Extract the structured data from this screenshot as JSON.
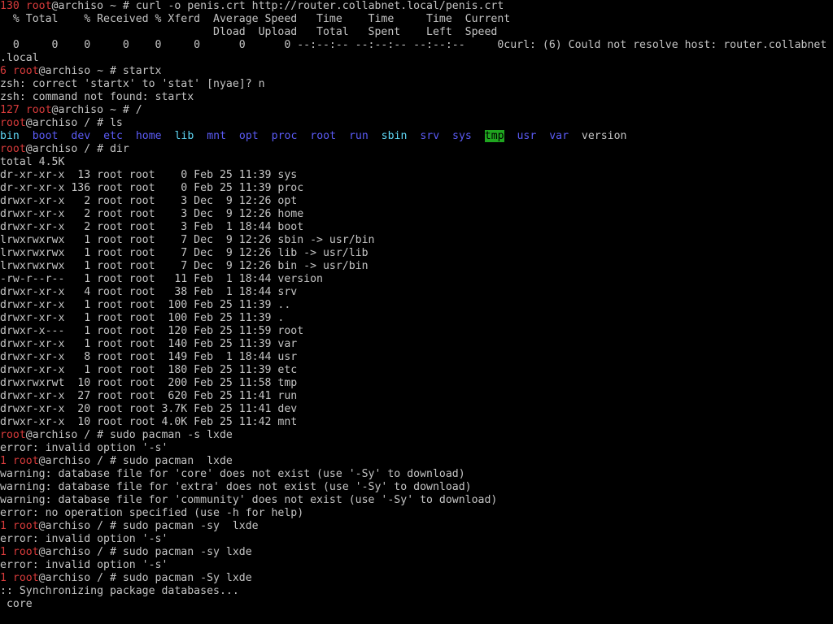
{
  "terminal": {
    "colors": {
      "background": "#000000",
      "foreground": "#c4c4c4",
      "prompt_status": "#d83b3b",
      "directory": "#5b5bf5",
      "symlink": "#5fd7f5",
      "sticky_dir_bg": "#1fa51f"
    },
    "lines": [
      [
        {
          "c": "red",
          "t": "130 root"
        },
        {
          "c": "default",
          "t": "@archiso ~ # curl -o penis.crt http://router.collabnet.local/penis.crt"
        }
      ],
      [
        {
          "c": "default",
          "t": "  % Total    % Received % Xferd  Average Speed   Time    Time     Time  Current"
        }
      ],
      [
        {
          "c": "default",
          "t": "                                 Dload  Upload   Total   Spent    Left  Speed"
        }
      ],
      [
        {
          "c": "default",
          "t": "  0     0    0     0    0     0      0      0 --:--:-- --:--:-- --:--:--     0curl: (6) Could not resolve host: router.collabnet"
        }
      ],
      [
        {
          "c": "default",
          "t": ".local"
        }
      ],
      [
        {
          "c": "red",
          "t": "6 root"
        },
        {
          "c": "default",
          "t": "@archiso ~ # startx"
        }
      ],
      [
        {
          "c": "default",
          "t": "zsh: correct 'startx' to 'stat' [nyae]? n"
        }
      ],
      [
        {
          "c": "default",
          "t": "zsh: command not found: startx"
        }
      ],
      [
        {
          "c": "red",
          "t": "127 root"
        },
        {
          "c": "default",
          "t": "@archiso ~ # /"
        }
      ],
      [
        {
          "c": "red",
          "t": "root"
        },
        {
          "c": "default",
          "t": "@archiso / # ls"
        }
      ],
      [
        {
          "c": "cyan",
          "t": "bin"
        },
        {
          "c": "default",
          "t": "  "
        },
        {
          "c": "blue",
          "t": "boot"
        },
        {
          "c": "default",
          "t": "  "
        },
        {
          "c": "blue",
          "t": "dev"
        },
        {
          "c": "default",
          "t": "  "
        },
        {
          "c": "blue",
          "t": "etc"
        },
        {
          "c": "default",
          "t": "  "
        },
        {
          "c": "blue",
          "t": "home"
        },
        {
          "c": "default",
          "t": "  "
        },
        {
          "c": "cyan",
          "t": "lib"
        },
        {
          "c": "default",
          "t": "  "
        },
        {
          "c": "blue",
          "t": "mnt"
        },
        {
          "c": "default",
          "t": "  "
        },
        {
          "c": "blue",
          "t": "opt"
        },
        {
          "c": "default",
          "t": "  "
        },
        {
          "c": "blue",
          "t": "proc"
        },
        {
          "c": "default",
          "t": "  "
        },
        {
          "c": "blue",
          "t": "root"
        },
        {
          "c": "default",
          "t": "  "
        },
        {
          "c": "blue",
          "t": "run"
        },
        {
          "c": "default",
          "t": "  "
        },
        {
          "c": "cyan",
          "t": "sbin"
        },
        {
          "c": "default",
          "t": "  "
        },
        {
          "c": "blue",
          "t": "srv"
        },
        {
          "c": "default",
          "t": "  "
        },
        {
          "c": "blue",
          "t": "sys"
        },
        {
          "c": "default",
          "t": "  "
        },
        {
          "c": "dirhl",
          "t": "tmp"
        },
        {
          "c": "default",
          "t": "  "
        },
        {
          "c": "blue",
          "t": "usr"
        },
        {
          "c": "default",
          "t": "  "
        },
        {
          "c": "blue",
          "t": "var"
        },
        {
          "c": "default",
          "t": "  version"
        }
      ],
      [
        {
          "c": "red",
          "t": "root"
        },
        {
          "c": "default",
          "t": "@archiso / # dir"
        }
      ],
      [
        {
          "c": "default",
          "t": "total 4.5K"
        }
      ],
      [
        {
          "c": "default",
          "t": "dr-xr-xr-x  13 root root    0 Feb 25 11:39 sys"
        }
      ],
      [
        {
          "c": "default",
          "t": "dr-xr-xr-x 136 root root    0 Feb 25 11:39 proc"
        }
      ],
      [
        {
          "c": "default",
          "t": "drwxr-xr-x   2 root root    3 Dec  9 12:26 opt"
        }
      ],
      [
        {
          "c": "default",
          "t": "drwxr-xr-x   2 root root    3 Dec  9 12:26 home"
        }
      ],
      [
        {
          "c": "default",
          "t": "drwxr-xr-x   2 root root    3 Feb  1 18:44 boot"
        }
      ],
      [
        {
          "c": "default",
          "t": "lrwxrwxrwx   1 root root    7 Dec  9 12:26 sbin -> usr/bin"
        }
      ],
      [
        {
          "c": "default",
          "t": "lrwxrwxrwx   1 root root    7 Dec  9 12:26 lib -> usr/lib"
        }
      ],
      [
        {
          "c": "default",
          "t": "lrwxrwxrwx   1 root root    7 Dec  9 12:26 bin -> usr/bin"
        }
      ],
      [
        {
          "c": "default",
          "t": "-rw-r--r--   1 root root   11 Feb  1 18:44 version"
        }
      ],
      [
        {
          "c": "default",
          "t": "drwxr-xr-x   4 root root   38 Feb  1 18:44 srv"
        }
      ],
      [
        {
          "c": "default",
          "t": "drwxr-xr-x   1 root root  100 Feb 25 11:39 .."
        }
      ],
      [
        {
          "c": "default",
          "t": "drwxr-xr-x   1 root root  100 Feb 25 11:39 ."
        }
      ],
      [
        {
          "c": "default",
          "t": "drwxr-x---   1 root root  120 Feb 25 11:59 root"
        }
      ],
      [
        {
          "c": "default",
          "t": "drwxr-xr-x   1 root root  140 Feb 25 11:39 var"
        }
      ],
      [
        {
          "c": "default",
          "t": "drwxr-xr-x   8 root root  149 Feb  1 18:44 usr"
        }
      ],
      [
        {
          "c": "default",
          "t": "drwxr-xr-x   1 root root  180 Feb 25 11:39 etc"
        }
      ],
      [
        {
          "c": "default",
          "t": "drwxrwxrwt  10 root root  200 Feb 25 11:58 tmp"
        }
      ],
      [
        {
          "c": "default",
          "t": "drwxr-xr-x  27 root root  620 Feb 25 11:41 run"
        }
      ],
      [
        {
          "c": "default",
          "t": "drwxr-xr-x  20 root root 3.7K Feb 25 11:41 dev"
        }
      ],
      [
        {
          "c": "default",
          "t": "drwxr-xr-x  10 root root 4.0K Feb 25 11:42 mnt"
        }
      ],
      [
        {
          "c": "red",
          "t": "root"
        },
        {
          "c": "default",
          "t": "@archiso / # sudo pacman -s lxde"
        }
      ],
      [
        {
          "c": "default",
          "t": "error: invalid option '-s'"
        }
      ],
      [
        {
          "c": "red",
          "t": "1 root"
        },
        {
          "c": "default",
          "t": "@archiso / # sudo pacman  lxde"
        }
      ],
      [
        {
          "c": "default",
          "t": "warning: database file for 'core' does not exist (use '-Sy' to download)"
        }
      ],
      [
        {
          "c": "default",
          "t": "warning: database file for 'extra' does not exist (use '-Sy' to download)"
        }
      ],
      [
        {
          "c": "default",
          "t": "warning: database file for 'community' does not exist (use '-Sy' to download)"
        }
      ],
      [
        {
          "c": "default",
          "t": "error: no operation specified (use -h for help)"
        }
      ],
      [
        {
          "c": "red",
          "t": "1 root"
        },
        {
          "c": "default",
          "t": "@archiso / # sudo pacman -sy  lxde"
        }
      ],
      [
        {
          "c": "default",
          "t": "error: invalid option '-s'"
        }
      ],
      [
        {
          "c": "red",
          "t": "1 root"
        },
        {
          "c": "default",
          "t": "@archiso / # sudo pacman -sy lxde"
        }
      ],
      [
        {
          "c": "default",
          "t": "error: invalid option '-s'"
        }
      ],
      [
        {
          "c": "red",
          "t": "1 root"
        },
        {
          "c": "default",
          "t": "@archiso / # sudo pacman -Sy lxde"
        }
      ],
      [
        {
          "c": "default",
          "t": ":: Synchronizing package databases..."
        }
      ],
      [
        {
          "c": "default",
          "t": " core"
        }
      ]
    ]
  }
}
